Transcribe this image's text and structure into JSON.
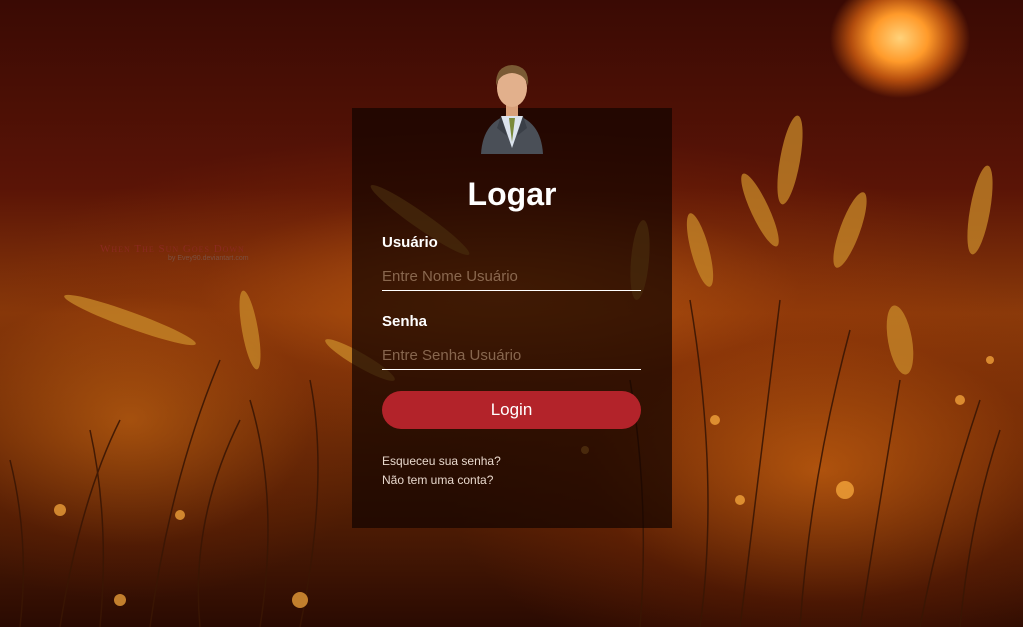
{
  "watermark": {
    "title": "When The Sun Goes Down",
    "credit": "by Evey90.deviantart.com"
  },
  "login": {
    "title": "Logar",
    "username_label": "Usuário",
    "username_placeholder": "Entre Nome Usuário",
    "password_label": "Senha",
    "password_placeholder": "Entre Senha Usuário",
    "submit_label": "Login",
    "forgot_link": "Esqueceu sua senha?",
    "register_link": "Não tem uma conta?"
  },
  "colors": {
    "button": "#b3232a",
    "panel": "#140400",
    "text": "#ffffff"
  },
  "icons": {
    "avatar": "businessman-avatar-icon"
  }
}
